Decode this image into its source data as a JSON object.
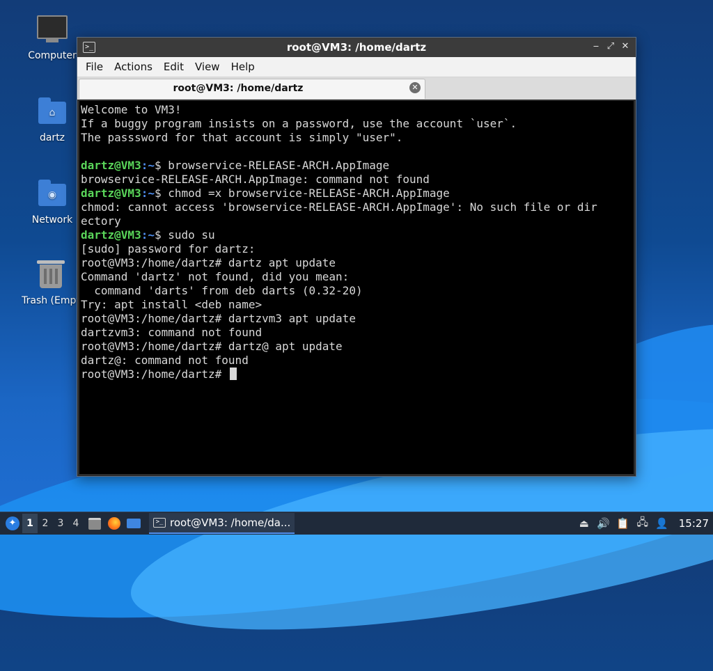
{
  "desktop": {
    "icons": [
      {
        "label": "Computer",
        "icon": "computer-icon"
      },
      {
        "label": "dartz",
        "icon": "home-folder-icon"
      },
      {
        "label": "Network",
        "icon": "network-folder-icon"
      },
      {
        "label": "Trash (Empt",
        "icon": "trash-icon"
      }
    ]
  },
  "window": {
    "title": "root@VM3: /home/dartz",
    "menu": [
      "File",
      "Actions",
      "Edit",
      "View",
      "Help"
    ],
    "tab_title": "root@VM3: /home/dartz"
  },
  "terminal": {
    "colors": {
      "user_prompt": "#5ad65a",
      "path_prompt": "#4f8ff0",
      "text": "#d8d8d8",
      "background": "#000000"
    },
    "lines": [
      {
        "text": "Welcome to VM3!"
      },
      {
        "text": "If a buggy program insists on a password, use the account `user`."
      },
      {
        "text": "The passsword for that account is simply \"user\"."
      },
      {
        "text": ""
      },
      {
        "prompt_user": "dartz@VM3",
        "prompt_path": ":~",
        "prompt_end": "$ ",
        "text": "browservice-RELEASE-ARCH.AppImage"
      },
      {
        "text": "browservice-RELEASE-ARCH.AppImage: command not found"
      },
      {
        "prompt_user": "dartz@VM3",
        "prompt_path": ":~",
        "prompt_end": "$ ",
        "text": "chmod =x browservice-RELEASE-ARCH.AppImage"
      },
      {
        "text": "chmod: cannot access 'browservice-RELEASE-ARCH.AppImage': No such file or dir"
      },
      {
        "text": "ectory"
      },
      {
        "prompt_user": "dartz@VM3",
        "prompt_path": ":~",
        "prompt_end": "$ ",
        "text": "sudo su"
      },
      {
        "text": "[sudo] password for dartz:"
      },
      {
        "text": "root@VM3:/home/dartz# dartz apt update"
      },
      {
        "text": "Command 'dartz' not found, did you mean:"
      },
      {
        "text": "  command 'darts' from deb darts (0.32-20)"
      },
      {
        "text": "Try: apt install <deb name>"
      },
      {
        "text": "root@VM3:/home/dartz# dartzvm3 apt update"
      },
      {
        "text": "dartzvm3: command not found"
      },
      {
        "text": "root@VM3:/home/dartz# dartz@ apt update"
      },
      {
        "text": "dartz@: command not found"
      },
      {
        "text": "root@VM3:/home/dartz# ",
        "cursor": true
      }
    ]
  },
  "taskbar": {
    "workspaces": [
      "1",
      "2",
      "3",
      "4"
    ],
    "active_workspace": "1",
    "task_label": "root@VM3: /home/da...",
    "clock": "15:27"
  }
}
